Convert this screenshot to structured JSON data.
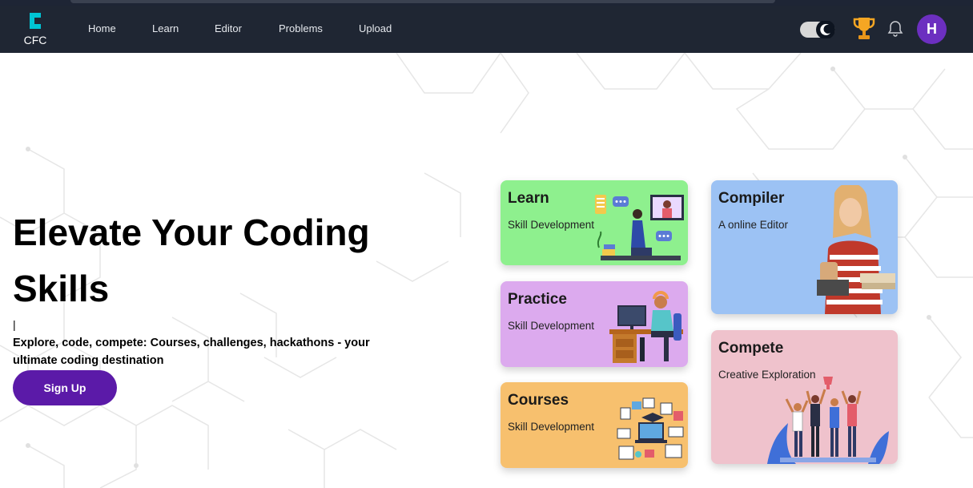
{
  "logo": {
    "text": "CFC"
  },
  "nav": {
    "links": [
      "Home",
      "Learn",
      "Editor",
      "Problems",
      "Upload"
    ]
  },
  "user": {
    "initial": "H"
  },
  "hero": {
    "title": "Elevate Your Coding Skills",
    "caret": "|",
    "subtitle": "Explore, code, compete: Courses, challenges, hackathons - your ultimate coding destination",
    "signup_label": "Sign Up"
  },
  "cards": [
    {
      "title": "Learn",
      "subtitle": "Skill Development",
      "color": "#8ef08e"
    },
    {
      "title": "Practice",
      "subtitle": "Skill Development",
      "color": "#dcaaee"
    },
    {
      "title": "Courses",
      "subtitle": "Skill Development",
      "color": "#f7c06e"
    },
    {
      "title": "Compiler",
      "subtitle": "A online Editor",
      "color": "#9cc2f4"
    },
    {
      "title": "Compete",
      "subtitle": "Creative Exploration",
      "color": "#efc2cc"
    }
  ],
  "colors": {
    "navbar": "#1f2633",
    "brand": "#00c4d4",
    "accent": "#5b1aa8",
    "trophy": "#f5a623"
  },
  "icons": [
    "logo-mark-icon",
    "theme-toggle-icon",
    "trophy-icon",
    "bell-icon"
  ]
}
